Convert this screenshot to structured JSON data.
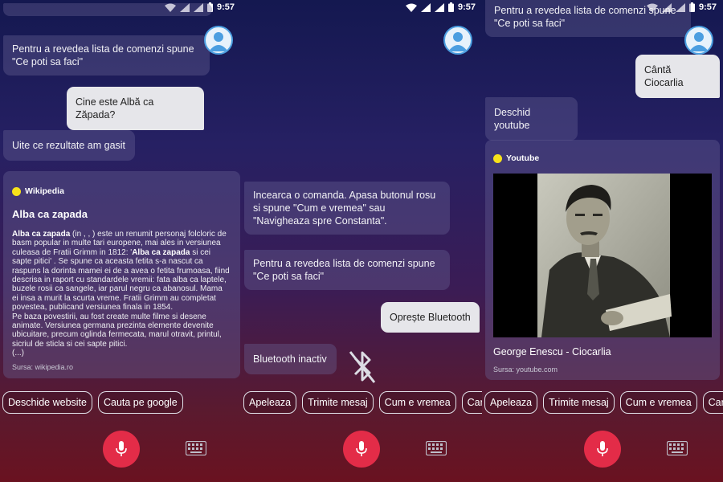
{
  "status": {
    "time": "9:57"
  },
  "screen1": {
    "bot_commands": "Pentru a revedea lista de comenzi spune \"Ce poti sa faci\"",
    "user_query": "Cine este Albă ca Zăpada?",
    "bot_results": "Uite ce rezultate am gasit",
    "card": {
      "source_name": "Wikipedia",
      "title": "Alba ca zapada",
      "p1_bold": "Alba ca zapada",
      "p1_a": " (in , , ) este un renumit personaj folcloric de basm popular in multe tari europene, mai ales in versiunea culeasa de Fratii Grimm in 1812: '",
      "p1_bold2": "Alba ca zapada",
      "p1_b": " si cei sapte pitici' . Se spune ca aceasta fetita s-a nascut ca raspuns la dorinta mamei ei de a avea o fetita frumoasa, fiind descrisa in raport cu standardele vremii: fata alba ca laptele, buzele rosii ca sangele, iar parul negru ca abanosul. Mama ei insa a murit la scurta vreme. Fratii Grimm au completat povestea, publicand versiunea finala in 1854.",
      "p2": "Pe baza povestirii, au fost create multe filme si desene animate. Versiunea germana prezinta elemente devenite ubicuitare, precum oglinda fermecata, marul otravit, printul, sicriul de sticla si cei sapte pitici.",
      "ellipsis": "(...)",
      "source_line": "Sursa: wikipedia.ro"
    },
    "chips": [
      "Deschide website",
      "Cauta pe google"
    ]
  },
  "screen2": {
    "bot_try": "Incearca o comanda. Apasa butonul rosu si spune \"Cum e vremea\" sau \"Navigheaza spre Constanta\".",
    "bot_commands": "Pentru a revedea lista de comenzi spune \"Ce poti sa faci\"",
    "user_command": "Oprește Bluetooth",
    "bot_bt": "Bluetooth inactiv",
    "chips": [
      "Apeleaza",
      "Trimite mesaj",
      "Cum e vremea",
      "Can"
    ]
  },
  "screen3": {
    "bot_commands": "Pentru a revedea lista de comenzi spune \"Ce poti sa faci\"",
    "user_command": "Cântă Ciocarlia",
    "bot_youtube": "Deschid youtube",
    "card": {
      "source_name": "Youtube",
      "video_title": "George Enescu - Ciocarlia",
      "source_line": "Sursa: youtube.com"
    },
    "chips": [
      "Apeleaza",
      "Trimite mesaj",
      "Cum e vremea",
      "Can"
    ]
  },
  "colors": {
    "mic": "#e32c48",
    "dot": "#f7e21a",
    "avatar_ring": "#4b9ee0"
  },
  "icons": [
    "wifi-icon",
    "signal-icon",
    "battery-icon",
    "user-avatar-icon",
    "microphone-icon",
    "keyboard-icon",
    "bluetooth-off-icon"
  ]
}
